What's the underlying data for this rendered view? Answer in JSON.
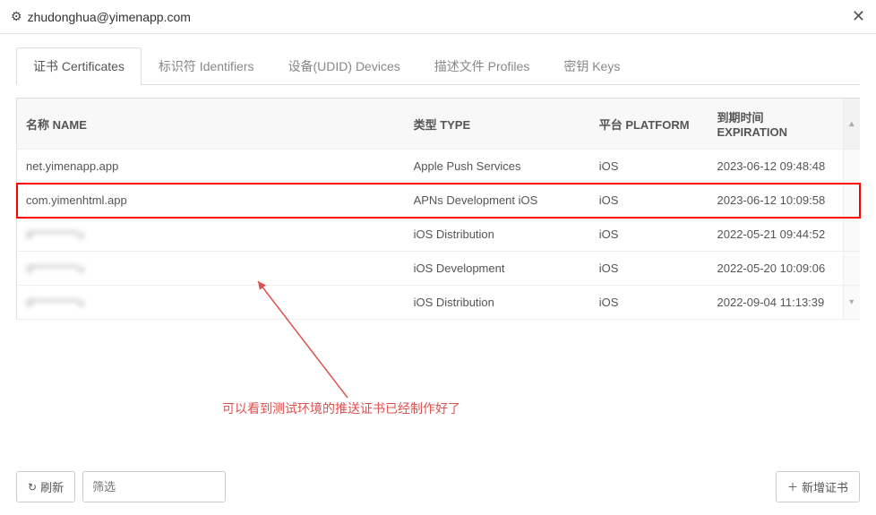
{
  "header": {
    "account": "zhudonghua@yimenapp.com",
    "icons": {
      "gear": "⚙",
      "close": "✕"
    }
  },
  "tabs": [
    {
      "key": "certificates",
      "label": "证书 Certificates",
      "active": true
    },
    {
      "key": "identifiers",
      "label": "标识符 Identifiers",
      "active": false
    },
    {
      "key": "devices",
      "label": "设备(UDID) Devices",
      "active": false
    },
    {
      "key": "profiles",
      "label": "描述文件 Profiles",
      "active": false
    },
    {
      "key": "keys",
      "label": "密钥 Keys",
      "active": false
    }
  ],
  "table": {
    "columns": {
      "name": "名称 NAME",
      "type": "类型 TYPE",
      "platform": "平台 PLATFORM",
      "expiration": "到期时间 EXPIRATION"
    },
    "rows": [
      {
        "name": "net.yimenapp.app",
        "type": "Apple Push Services",
        "platform": "iOS",
        "expiration": "2023-06-12 09:48:48",
        "highlight": false,
        "obscured": false
      },
      {
        "name": "com.yimenhtml.app",
        "type": "APNs Development iOS",
        "platform": "iOS",
        "expiration": "2023-06-12 10:09:58",
        "highlight": true,
        "obscured": false
      },
      {
        "name": "d**********u",
        "type": "iOS Distribution",
        "platform": "iOS",
        "expiration": "2022-05-21 09:44:52",
        "highlight": false,
        "obscured": true
      },
      {
        "name": "d**********u",
        "type": "iOS Development",
        "platform": "iOS",
        "expiration": "2022-05-20 10:09:06",
        "highlight": false,
        "obscured": true
      },
      {
        "name": "d**********u",
        "type": "iOS Distribution",
        "platform": "iOS",
        "expiration": "2022-09-04 11:13:39",
        "highlight": false,
        "obscured": true
      }
    ]
  },
  "footer": {
    "refresh_label": "刷新",
    "filter_placeholder": "筛选",
    "add_label": "新增证书",
    "icons": {
      "refresh": "↻",
      "plus": "＋"
    }
  },
  "annotation": {
    "text": "可以看到测试环境的推送证书已经制作好了",
    "color": "#d9534f"
  }
}
